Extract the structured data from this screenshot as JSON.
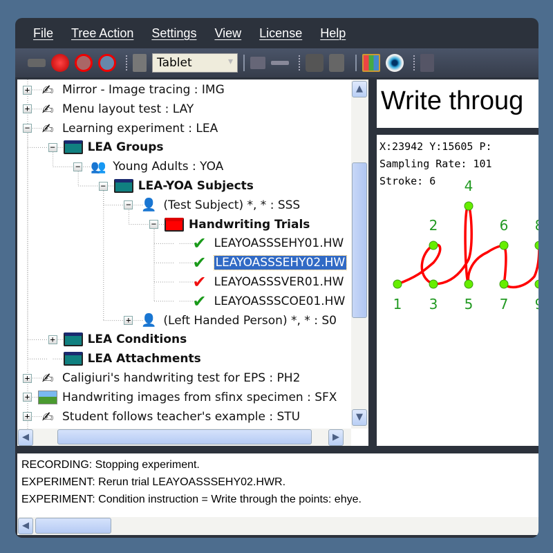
{
  "menu": [
    "File",
    "Tree Action",
    "Settings",
    "View",
    "License",
    "Help"
  ],
  "toolbar": {
    "device_combo": "Tablet",
    "icons": [
      "arrow-right-icon",
      "stop-icon",
      "no-hand-icon",
      "no-pen-icon",
      "tools-icon",
      "waveform-icon",
      "line-icon",
      "binoculars-icon",
      "export-icon",
      "palette-icon",
      "eye-icon",
      "font-icon"
    ]
  },
  "tree": [
    {
      "level": 0,
      "exp": "+",
      "icon": "pen-hand",
      "label": "Mirror - Image tracing : IMG"
    },
    {
      "level": 0,
      "exp": "+",
      "icon": "pen-hand",
      "label": "Menu layout test : LAY"
    },
    {
      "level": 0,
      "exp": "-",
      "icon": "pen-hand",
      "label": "Learning experiment : LEA"
    },
    {
      "level": 1,
      "exp": "-",
      "icon": "folder",
      "label": "LEA Groups",
      "bold": true
    },
    {
      "level": 2,
      "exp": "-",
      "icon": "group",
      "label": "Young Adults : YOA"
    },
    {
      "level": 3,
      "exp": "-",
      "icon": "folder",
      "label": "LEA-YOA Subjects",
      "bold": true
    },
    {
      "level": 4,
      "exp": "-",
      "icon": "person",
      "label": "(Test Subject) *, * : SSS"
    },
    {
      "level": 5,
      "exp": "-",
      "icon": "folder-red",
      "label": "Handwriting Trials",
      "bold": true
    },
    {
      "level": 6,
      "exp": "",
      "icon": "check-green",
      "label": "LEAYOASSSEHY01.HW"
    },
    {
      "level": 6,
      "exp": "",
      "icon": "check-green",
      "label": "LEAYOASSSEHY02.HW",
      "selected": true
    },
    {
      "level": 6,
      "exp": "",
      "icon": "check-red",
      "label": "LEAYOASSSVER01.HW"
    },
    {
      "level": 6,
      "exp": "",
      "icon": "check-green",
      "label": "LEAYOASSSCOE01.HW"
    },
    {
      "level": 4,
      "exp": "+",
      "icon": "person",
      "label": "(Left Handed Person) *, * : S0"
    },
    {
      "level": 1,
      "exp": "+",
      "icon": "folder",
      "label": "LEA Conditions",
      "bold": true
    },
    {
      "level": 1,
      "exp": "",
      "icon": "folder",
      "label": "LEA Attachments",
      "bold": true
    },
    {
      "level": 0,
      "exp": "+",
      "icon": "pen-hand",
      "label": "Caligiuri's handwriting test for EPS : PH2"
    },
    {
      "level": 0,
      "exp": "+",
      "icon": "landscape",
      "label": "Handwriting images from sfinx specimen : SFX"
    },
    {
      "level": 0,
      "exp": "+",
      "icon": "pen-hand",
      "label": "Student follows teacher's example : STU"
    }
  ],
  "instruction_title": "Write throug",
  "readout": {
    "coords": "X:23942 Y:15605 P:",
    "sampling": "Sampling Rate: 101",
    "stroke": "Stroke: 6"
  },
  "target_points": [
    "1",
    "2",
    "3",
    "4",
    "5",
    "6",
    "7",
    "8",
    "9"
  ],
  "colors": {
    "stroke": "#ff0000",
    "point": "#66ee00",
    "label": "#229922",
    "selection": "#316ac5"
  },
  "log": [
    "RECORDING: Stopping experiment.",
    "EXPERIMENT: Rerun trial LEAYOASSSEHY02.HWR.",
    "EXPERIMENT: Condition instruction = Write through the points: ehye."
  ]
}
